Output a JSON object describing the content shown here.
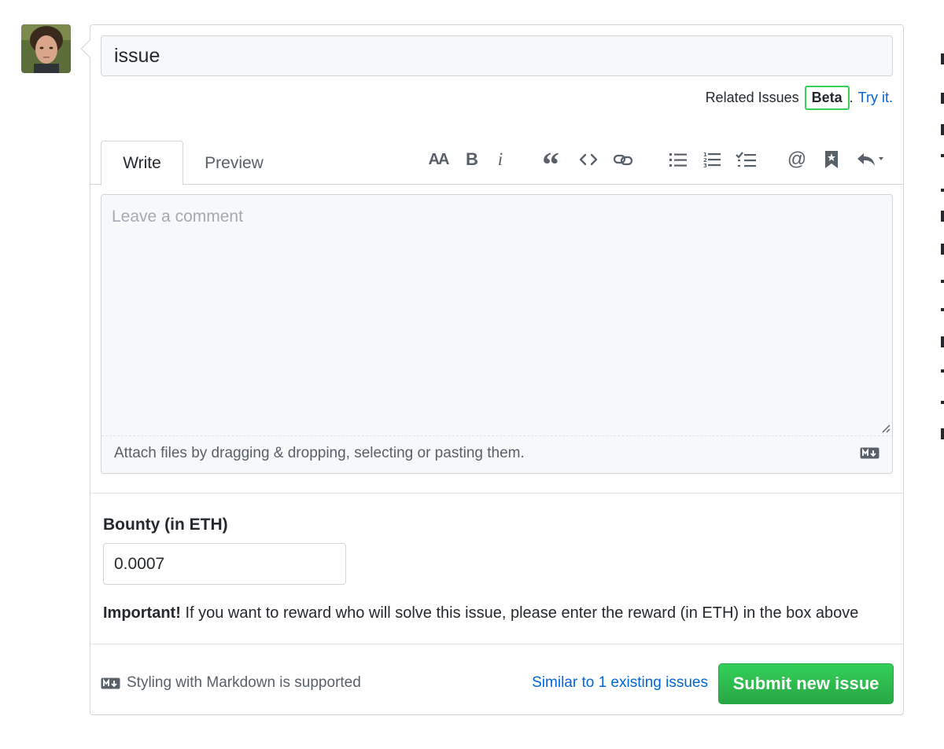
{
  "title_input": {
    "value": "issue"
  },
  "related": {
    "label": "Related Issues",
    "beta": "Beta",
    "period": ".",
    "try_it": "Try it."
  },
  "tabs": {
    "write": "Write",
    "preview": "Preview"
  },
  "toolbar": {
    "icons": [
      "text-size-icon",
      "bold-icon",
      "italic-icon",
      "quote-icon",
      "code-icon",
      "link-icon",
      "bulleted-list-icon",
      "numbered-list-icon",
      "task-list-icon",
      "mention-icon",
      "reference-icon",
      "reply-icon"
    ],
    "header_glyph": "AA",
    "bold_glyph": "B",
    "italic_glyph": "i",
    "quote_glyph": "“",
    "mention_glyph": "@"
  },
  "comment": {
    "placeholder": "Leave a comment",
    "attach_text": "Attach files by dragging & dropping, selecting or pasting them."
  },
  "bounty": {
    "label": "Bounty (in ETH)",
    "value": "0.0007",
    "important_bold": "Important!",
    "important_text": " If you want to reward who will solve this issue, please enter the reward (in ETH) in the box above"
  },
  "footer": {
    "markdown_note": "Styling with Markdown is supported",
    "similar_link": "Similar to 1 existing issues",
    "submit_label": "Submit new issue"
  },
  "colors": {
    "accent_link": "#0366d6",
    "submit_green": "#28a745",
    "beta_border": "#34d058",
    "border": "#d1d5da"
  }
}
